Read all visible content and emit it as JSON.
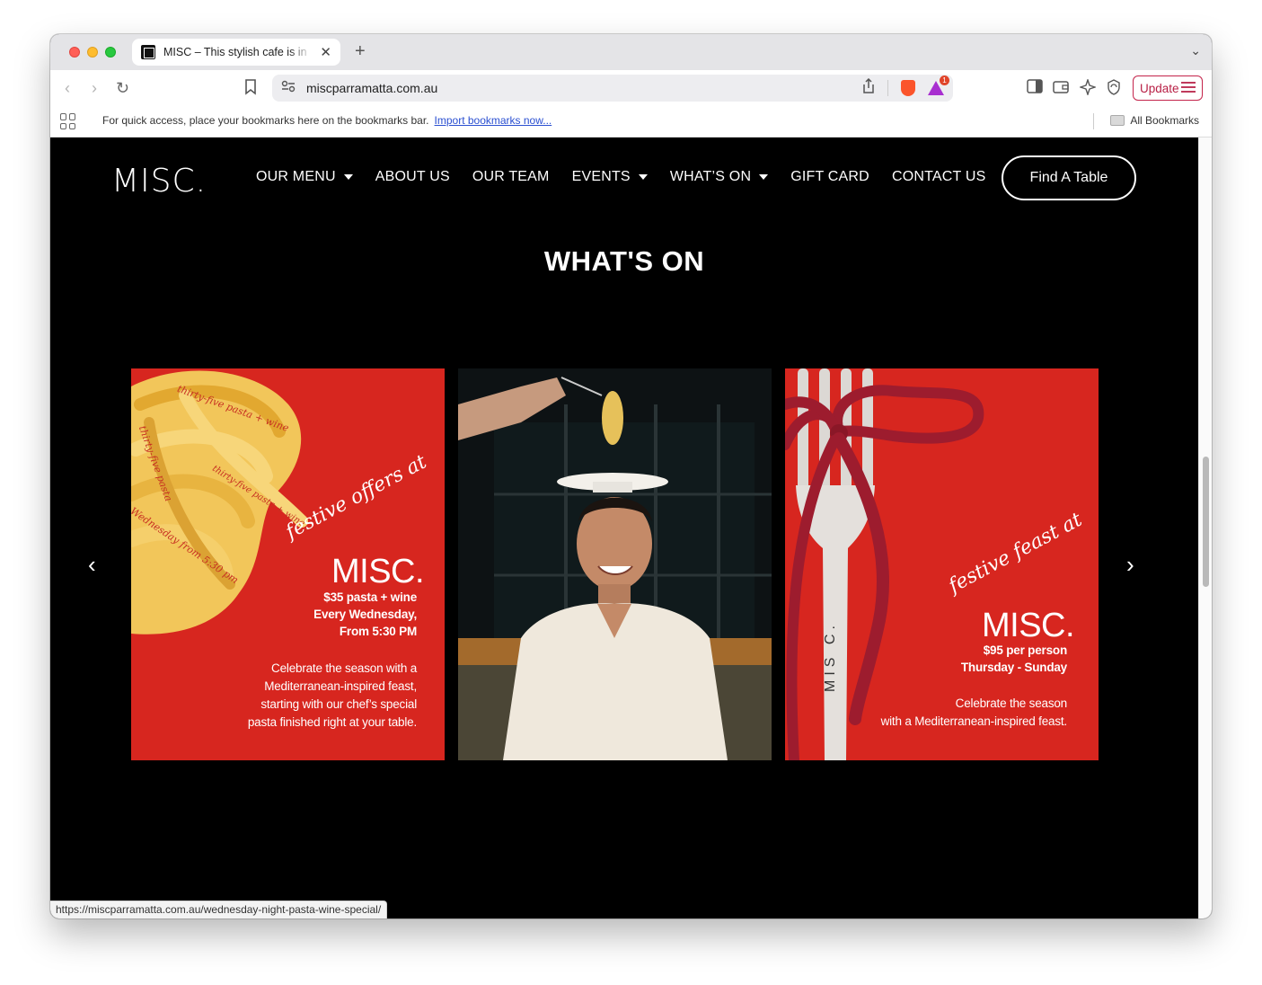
{
  "browser": {
    "tab_title": "MISC – This stylish cafe is in",
    "url": "miscparramatta.com.au",
    "update_label": "Update",
    "bookmarks_hint": "For quick access, place your bookmarks here on the bookmarks bar.",
    "import_link": "Import bookmarks now...",
    "all_bookmarks": "All Bookmarks",
    "brave_badge": "1",
    "status_url": "https://miscparramatta.com.au/wednesday-night-pasta-wine-special/"
  },
  "site": {
    "logo": "MISC.",
    "nav": [
      "OUR MENU",
      "ABOUT US",
      "OUR TEAM",
      "EVENTS",
      "WHAT’S ON",
      "GIFT CARD",
      "CONTACT US"
    ],
    "cta": "Find A Table",
    "section_title": "WHAT'S ON"
  },
  "cards": {
    "card1": {
      "ribbon_1": "thirty-five pasta + wine",
      "ribbon_2": "thirty-five pasta",
      "ribbon_3": "Wednesday from 5:30 pm",
      "ribbon_4": "thirty-five pasta + wine",
      "script": "festive offers at",
      "brand": "MISC.",
      "price": "$35 pasta + wine",
      "when": "Every Wednesday,",
      "time": "From 5:30 PM",
      "desc_1": "Celebrate the season with a",
      "desc_2": "Mediterranean-inspired feast,",
      "desc_3": "starting with our chef’s special",
      "desc_4": "pasta finished right at your table."
    },
    "card3": {
      "script": "festive feast at",
      "brand": "MISC.",
      "price": "$95 per person",
      "when": "Thursday - Sunday",
      "desc_1": "Celebrate the season",
      "desc_2": "with a Mediterranean-inspired feast.",
      "fork_engraving": "MIS C."
    }
  },
  "colors": {
    "page_bg": "#000000",
    "card_red": "#d7261f",
    "ribbon": "#9d1c2e",
    "pasta": "#f2c65a",
    "update_accent": "#c4244b"
  },
  "icons": [
    "back-icon",
    "forward-icon",
    "reload-icon",
    "bookmark-icon",
    "site-settings-icon",
    "share-icon",
    "brave-shields-icon",
    "brave-rewards-icon",
    "sidebar-icon",
    "wallet-icon",
    "leo-ai-icon",
    "vpn-icon",
    "menu-icon",
    "carousel-prev-icon",
    "carousel-next-icon"
  ]
}
